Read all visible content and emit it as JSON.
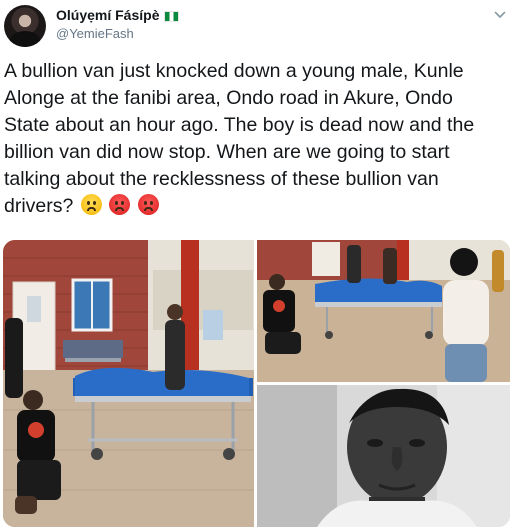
{
  "user": {
    "display_name": "Olúyẹmí Fásípè",
    "handle": "@YemieFash",
    "flag_icon": "nigeria-flag-icon"
  },
  "tweet": {
    "lines": [
      "A bullion van just knocked down a young male, Kunle",
      "Alonge at the fanibi area, Ondo road in Akure, Ondo",
      "State about an hour ago. The boy is dead now and the",
      "billion van did now stop. When are we going to start",
      "talking about the recklessness of these bullion van",
      "drivers?"
    ],
    "emojis": [
      "worried-face-emoji",
      "pouting-face-emoji",
      "pouting-face-emoji"
    ]
  },
  "media": {
    "photos": [
      "stretcher-scene-photo",
      "crowd-around-stretcher-photo",
      "portrait-photo-bw"
    ]
  },
  "colors": {
    "text": "#14171a",
    "secondary": "#657786",
    "brick": "#a0463a",
    "sheet_blue": "#1f5fb4"
  }
}
